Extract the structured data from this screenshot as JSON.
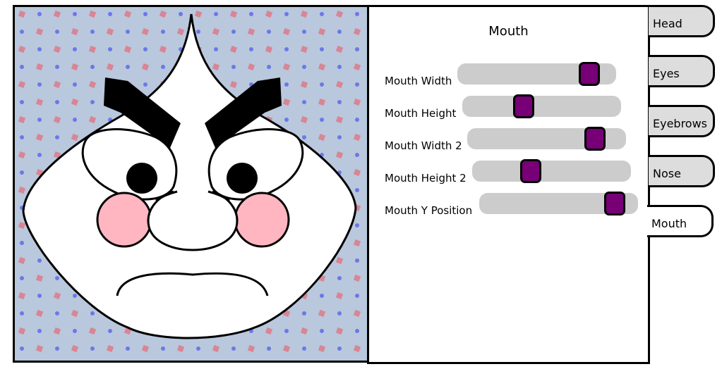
{
  "panel": {
    "title": "Mouth"
  },
  "sliders": [
    {
      "label": "Mouth Width",
      "value": 0.88
    },
    {
      "label": "Mouth Height",
      "value": 0.37
    },
    {
      "label": "Mouth Width 2",
      "value": 0.85
    },
    {
      "label": "Mouth Height 2",
      "value": 0.35
    },
    {
      "label": "Mouth Y Position",
      "value": 0.91
    }
  ],
  "tabs": [
    {
      "label": "Head",
      "active": false
    },
    {
      "label": "Eyes",
      "active": false
    },
    {
      "label": "Eyebrows",
      "active": false
    },
    {
      "label": "Nose",
      "active": false
    },
    {
      "label": "Mouth",
      "active": true
    }
  ],
  "colors": {
    "slider_thumb": "#770077",
    "slider_track": "#cccccc",
    "background": "#b9c8dc",
    "cheek": "#ffb6c1"
  }
}
